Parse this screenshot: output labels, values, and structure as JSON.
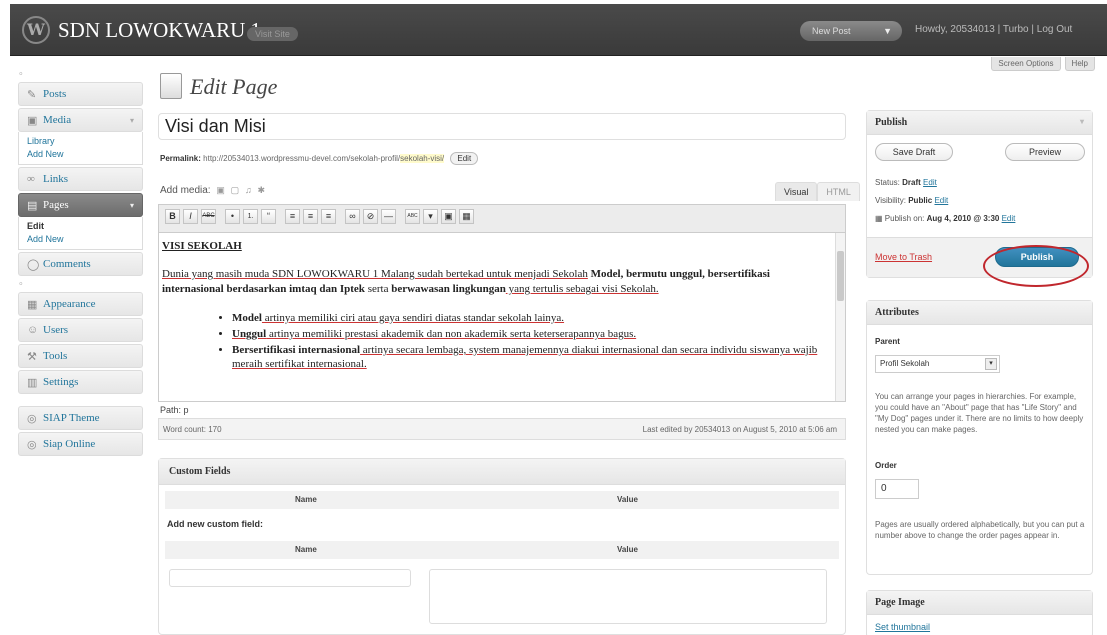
{
  "header": {
    "logo_glyph": "W",
    "site_title": "SDN LOWOKWARU 1",
    "visit_site": "Visit Site",
    "favorite_action": "New Post",
    "howdy": "Howdy, 20534013 | Turbo | Log Out"
  },
  "sidebar": {
    "items": [
      {
        "label": "Posts",
        "icon": "pin-icon"
      },
      {
        "label": "Media",
        "icon": "media-icon",
        "sub": [
          "Library",
          "Add New"
        ]
      },
      {
        "label": "Links",
        "icon": "link-icon"
      },
      {
        "label": "Pages",
        "icon": "pages-icon",
        "sub": [
          "Edit",
          "Add New"
        ]
      },
      {
        "label": "Comments",
        "icon": "comments-icon"
      },
      {
        "label": "Appearance",
        "icon": "appearance-icon"
      },
      {
        "label": "Users",
        "icon": "users-icon"
      },
      {
        "label": "Tools",
        "icon": "tools-icon"
      },
      {
        "label": "Settings",
        "icon": "settings-icon"
      },
      {
        "label": "SIAP Theme",
        "icon": "theme-icon"
      },
      {
        "label": "Siap Online",
        "icon": "online-icon"
      }
    ]
  },
  "top_buttons": {
    "screen_options": "Screen Options",
    "help": "Help"
  },
  "page": {
    "heading": "Edit Page",
    "title_value": "Visi dan Misi",
    "permalink_label": "Permalink:",
    "permalink_url": "http://20534013.wordpressmu-devel.com/sekolah-profil/",
    "permalink_slug": "sekolah-visi/",
    "permalink_edit": "Edit",
    "add_media": "Add media:",
    "tab_visual": "Visual",
    "tab_html": "HTML"
  },
  "toolbar": [
    "B",
    "I",
    "ABC",
    "•",
    "1.",
    "“",
    "≡",
    "≡",
    "≡",
    "∞",
    "⊘",
    "—",
    "ABC",
    "▾",
    "▣",
    "▦"
  ],
  "editor": {
    "heading": "VISI SEKOLAH",
    "p1_a": "Dunia yang ",
    "p1_b": "masih muda SDN LOWOKWARU 1 Malang sudah bertekad untuk menjadi Sekolah",
    "p1_c": " Model, bermutu unggul, bersertifikasi internasional berdasarkan imtaq dan Iptek",
    "p1_d": " serta ",
    "p1_e": "berwawasan lingkungan",
    "p1_f": " yang tertulis sebagai visi Sekolah.",
    "b1_bold": "Model",
    "b1_rest": " artinya memiliki ciri atau gaya sendiri diatas standar sekolah lainya.",
    "b2_bold": "Unggul",
    "b2_rest": " artinya memiliki prestasi akademik dan non akademik serta keterserapannya bagus.",
    "b3_bold": "Bersertifikasi internasional",
    "b3_rest": " artinya secara lembaga, system manajemennya diakui internasional dan secara individu siswanya wajib meraih sertifikat internasional."
  },
  "status": {
    "path": "Path: p",
    "word_count": "Word count: 170",
    "last_edited": "Last edited by 20534013 on August 5, 2010 at 5:06 am"
  },
  "custom_fields": {
    "title": "Custom Fields",
    "col_name": "Name",
    "col_value": "Value",
    "add_new": "Add new custom field:"
  },
  "publish": {
    "title": "Publish",
    "save_draft": "Save Draft",
    "preview": "Preview",
    "status_label": "Status:",
    "status_value": "Draft",
    "visibility_label": "Visibility:",
    "visibility_value": "Public",
    "publish_on_label": "Publish on:",
    "publish_on_value": "Aug 4, 2010 @ 3:30",
    "edit": "Edit",
    "move_to_trash": "Move to Trash",
    "publish_button": "Publish"
  },
  "attributes": {
    "title": "Attributes",
    "parent_label": "Parent",
    "parent_value": "Profil Sekolah",
    "help1": "You can arrange your pages in hierarchies. For example, you could have an \"About\" page that has \"Life Story\" and \"My Dog\" pages under it. There are no limits to how deeply nested you can make pages.",
    "order_label": "Order",
    "order_value": "0",
    "help2": "Pages are usually ordered alphabetically, but you can put a number above to change the order pages appear in."
  },
  "page_image": {
    "title": "Page Image",
    "set_thumbnail": "Set thumbnail"
  },
  "colors": {
    "link": "#21759b",
    "publish_button": "#21759b",
    "highlight_oval": "#c0272d"
  }
}
